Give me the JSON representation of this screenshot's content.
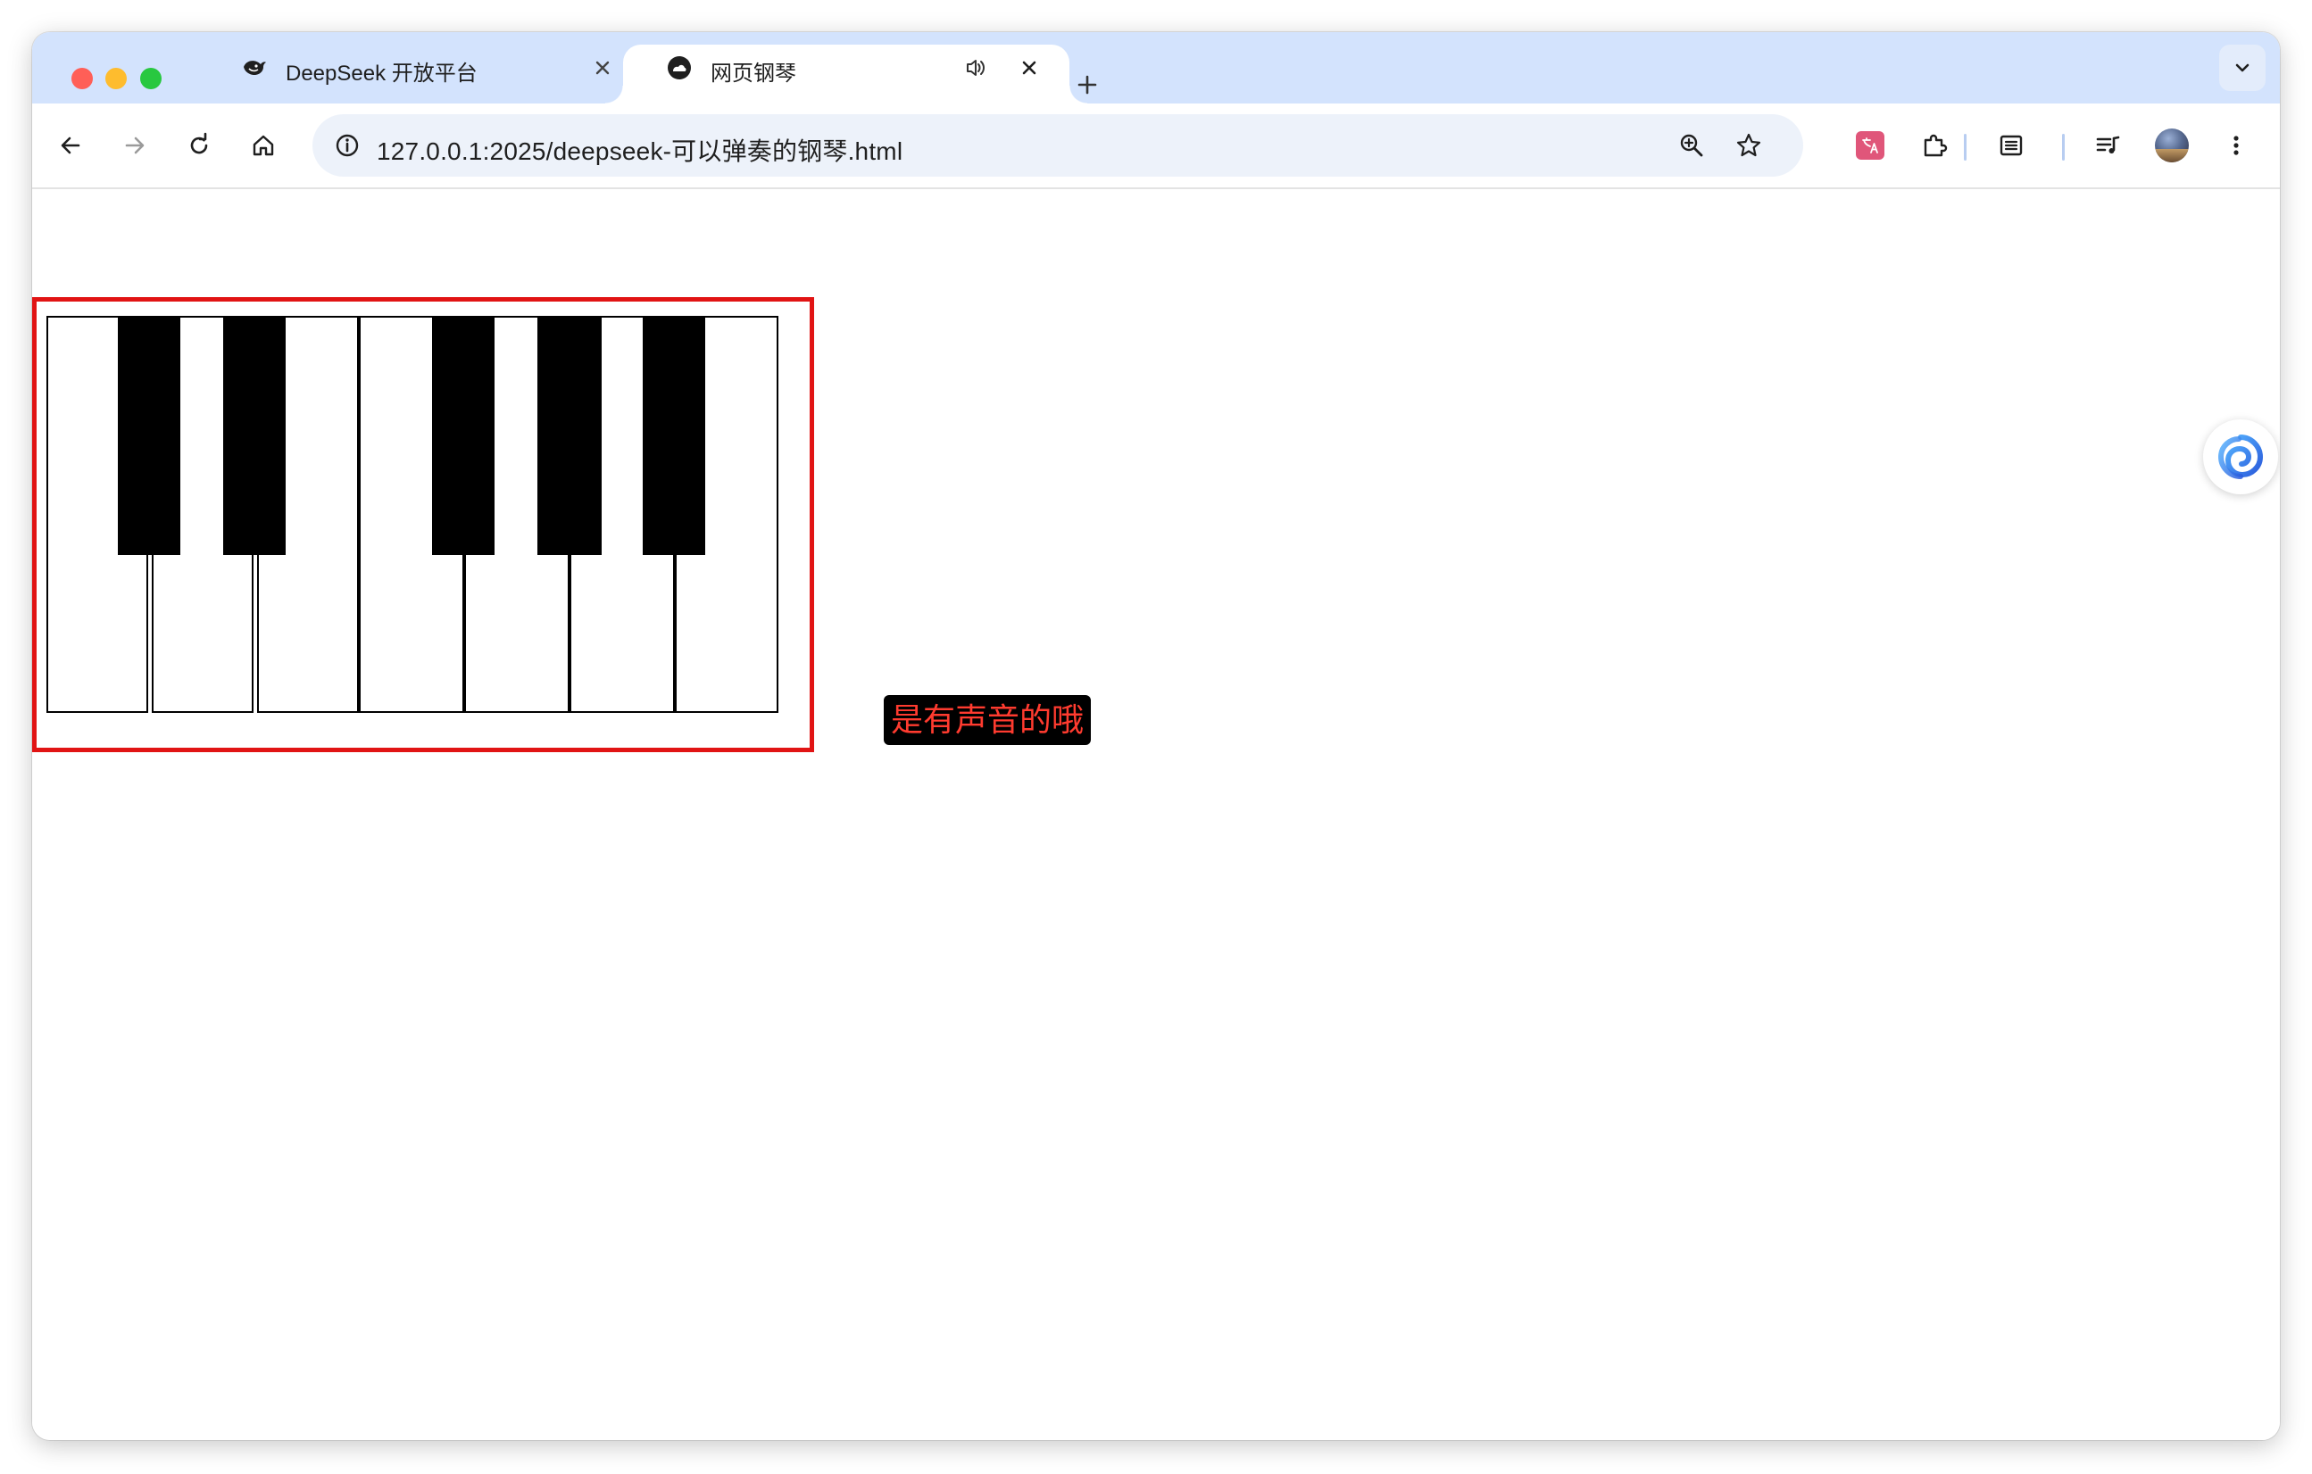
{
  "window": {
    "controls": [
      "close",
      "minimize",
      "zoom"
    ]
  },
  "tabs": [
    {
      "title": "DeepSeek 开放平台",
      "favicon": "deepseek-whale-icon",
      "active": false
    },
    {
      "title": "网页钢琴",
      "favicon": "page-icon",
      "active": true,
      "audio": true
    }
  ],
  "toolbar": {
    "url": "127.0.0.1:2025/deepseek-可以弹奏的钢琴.html"
  },
  "piano": {
    "white_keys": 7,
    "black_keys": 5
  },
  "overlay": {
    "label": "是有声音的哦"
  },
  "colors": {
    "tabstrip": "#d3e3fd",
    "highlight_border": "#e11414",
    "label_text": "#ff3b2f",
    "label_bg": "#000000"
  }
}
